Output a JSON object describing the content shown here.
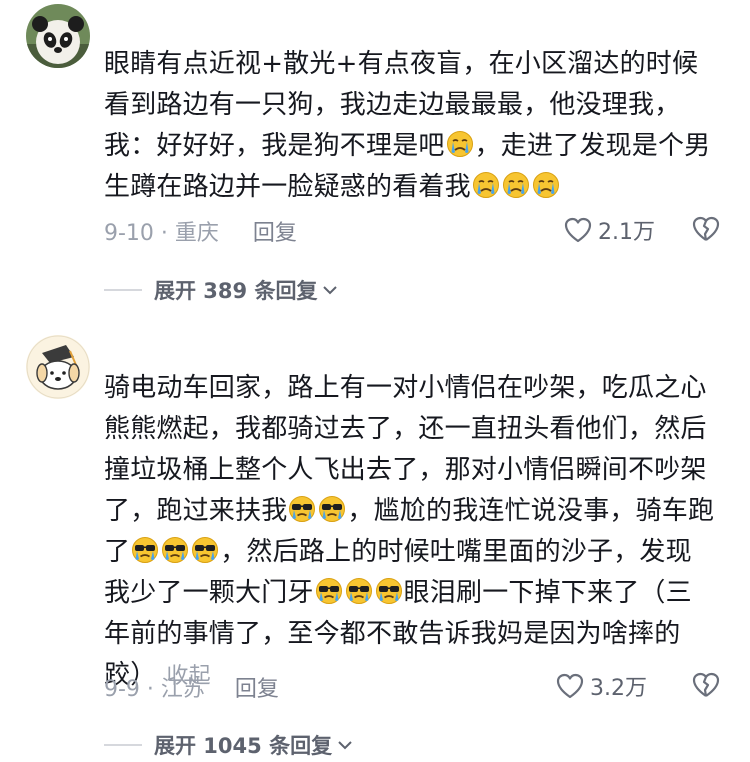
{
  "comments": [
    {
      "avatar_icon": "panda-avatar",
      "segments": [
        {
          "t": "眼睛有点近视+散光+有点夜盲，在小区溜达的时候看到路边有一只狗，我边走边最最最，他没理我，我：好好好，我是狗不理是吧"
        },
        {
          "e": "crying-emoji"
        },
        {
          "t": "，走进了发现是个男生蹲在路边并一脸疑惑的看着我"
        },
        {
          "e": "crying-emoji"
        },
        {
          "e": "crying-emoji"
        },
        {
          "e": "crying-emoji"
        }
      ],
      "date_location": "9-10 · 重庆",
      "reply_label": "回复",
      "like_count": "2.1万",
      "expand_label": "展开 389 条回复"
    },
    {
      "avatar_icon": "cartoon-dog-avatar",
      "segments": [
        {
          "t": "骑电动车回家，路上有一对小情侣在吵架，吃瓜之心熊熊燃起，我都骑过去了，还一直扭头看他们，然后撞垃圾桶上整个人飞出去了，那对小情侣瞬间不吵架了，跑过来扶我"
        },
        {
          "e": "sunglasses-crying-emoji"
        },
        {
          "e": "sunglasses-crying-emoji"
        },
        {
          "t": "，尴尬的我连忙说没事，骑车跑了"
        },
        {
          "e": "sunglasses-crying-emoji"
        },
        {
          "e": "sunglasses-crying-emoji"
        },
        {
          "e": "sunglasses-crying-emoji"
        },
        {
          "t": "，然后路上的时候吐嘴里面的沙子，发现我少了一颗大门牙"
        },
        {
          "e": "sunglasses-crying-emoji"
        },
        {
          "e": "sunglasses-crying-emoji"
        },
        {
          "e": "sunglasses-crying-emoji"
        },
        {
          "t": "眼泪刷一下掉下来了（三年前的事情了，至今都不敢告诉我妈是因为啥摔的跤）"
        }
      ],
      "collapse_label": "收起",
      "date_location": "9-9 · 江苏",
      "reply_label": "回复",
      "like_count": "3.2万",
      "expand_label": "展开 1045 条回复"
    }
  ],
  "colors": {
    "text": "#16181f",
    "meta": "#9aa0ac",
    "emoji_face": "#f7c531",
    "tears": "#4aa3e8"
  }
}
